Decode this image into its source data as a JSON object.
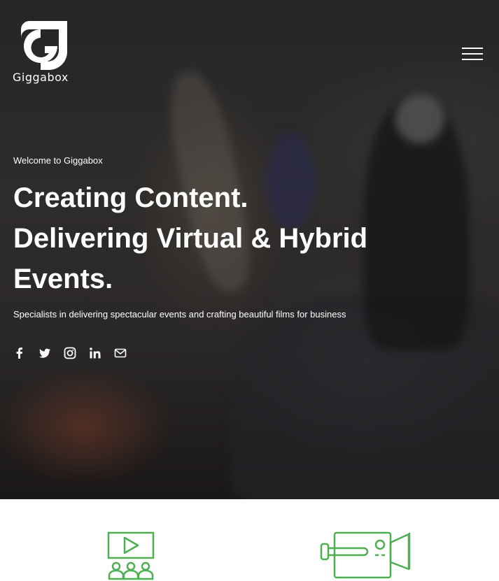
{
  "brand": {
    "logo_text": "Giggabox"
  },
  "header": {
    "menu_icon": "hamburger-menu-icon"
  },
  "hero": {
    "kicker": "Welcome to Giggabox",
    "headline_lines": [
      "Creating Content.",
      "Delivering Virtual & Hybrid",
      "Events."
    ],
    "subline": "Specialists in delivering spectacular events and crafting beautiful films for business"
  },
  "social": [
    {
      "icon": "facebook-icon"
    },
    {
      "icon": "twitter-icon"
    },
    {
      "icon": "instagram-icon"
    },
    {
      "icon": "linkedin-icon"
    },
    {
      "icon": "email-icon"
    }
  ],
  "services": [
    {
      "icon": "video-screening-icon"
    },
    {
      "icon": "video-camera-icon"
    }
  ],
  "colors": {
    "accent_green": "#4caf50",
    "text_white": "#ffffff",
    "hero_dark": "#262626"
  }
}
